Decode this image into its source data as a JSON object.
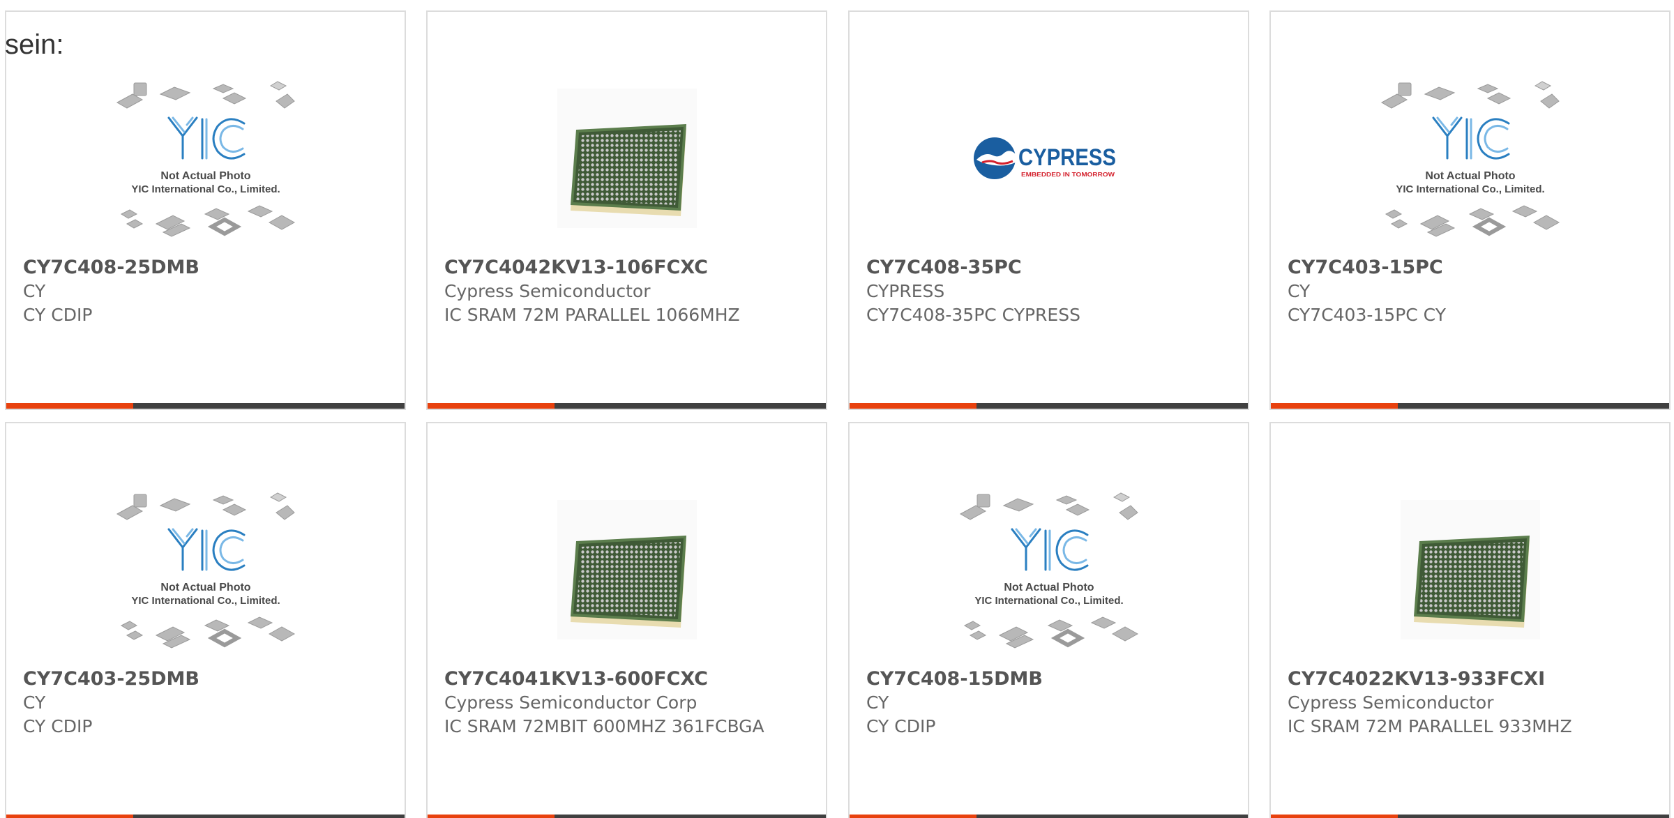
{
  "intro_text": "sein:",
  "colors": {
    "accent": "#e8410e",
    "bar": "#404040",
    "border": "#dcdcdc",
    "yic_blue": "#2a7fc1",
    "cypress_blue": "#1a5ea0",
    "cypress_red": "#d4202c"
  },
  "placeholder": {
    "line1": "Not Actual Photo",
    "line2": "YIC International Co., Limited."
  },
  "cypress_logo": {
    "brand": "CYPRESS",
    "tagline": "EMBEDDED IN TOMORROW"
  },
  "products": [
    {
      "image": "yic-placeholder-icon",
      "part": "CY7C408-25DMB",
      "maker": "CY",
      "desc": "CY CDIP"
    },
    {
      "image": "bga-chip-icon",
      "part": "CY7C4042KV13-106FCXC",
      "maker": "Cypress Semiconductor",
      "desc": "IC SRAM 72M PARALLEL 1066MHZ"
    },
    {
      "image": "cypress-logo",
      "part": "CY7C408-35PC",
      "maker": "CYPRESS",
      "desc": "CY7C408-35PC CYPRESS"
    },
    {
      "image": "yic-placeholder-icon",
      "part": "CY7C403-15PC",
      "maker": "CY",
      "desc": "CY7C403-15PC CY"
    },
    {
      "image": "yic-placeholder-icon",
      "part": "CY7C403-25DMB",
      "maker": "CY",
      "desc": "CY CDIP"
    },
    {
      "image": "bga-chip-icon",
      "part": "CY7C4041KV13-600FCXC",
      "maker": "Cypress Semiconductor Corp",
      "desc": "IC SRAM 72MBIT 600MHZ 361FCBGA"
    },
    {
      "image": "yic-placeholder-icon",
      "part": "CY7C408-15DMB",
      "maker": "CY",
      "desc": "CY CDIP"
    },
    {
      "image": "bga-chip-icon",
      "part": "CY7C4022KV13-933FCXI",
      "maker": "Cypress Semiconductor",
      "desc": "IC SRAM 72M PARALLEL 933MHZ"
    }
  ]
}
